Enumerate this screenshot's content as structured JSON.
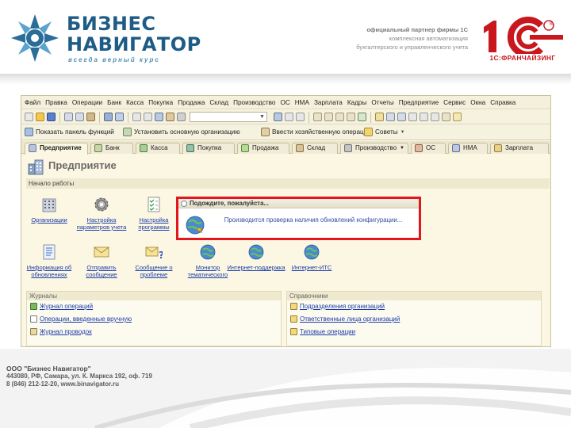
{
  "header": {
    "brand_line1": "БИЗНЕС",
    "brand_line2": "НАВИГАТОР",
    "tagline": "всегда верный курс",
    "partner_line1": "официальный партнер фирмы 1С",
    "partner_line2": "комплексная автоматизация",
    "partner_line3": "бухгалтерского и управленческого учета",
    "franchise_label": "1С:ФРАНЧАЙЗИНГ"
  },
  "app": {
    "menu": [
      "Файл",
      "Правка",
      "Операции",
      "Банк",
      "Касса",
      "Покупка",
      "Продажа",
      "Склад",
      "Производство",
      "ОС",
      "НМА",
      "Зарплата",
      "Кадры",
      "Отчеты",
      "Предприятие",
      "Сервис",
      "Окна",
      "Справка"
    ],
    "toolbar2": {
      "show_panel": "Показать панель функций",
      "set_org": "Установить основную организацию",
      "enter_op": "Ввести хозяйственную операцию",
      "advice": "Советы"
    },
    "tabs": [
      "Предприятие",
      "Банк",
      "Касса",
      "Покупка",
      "Продажа",
      "Склад",
      "Производство",
      "ОС",
      "НМА",
      "Зарплата"
    ],
    "page_title": "Предприятие",
    "section_start": "Начало работы",
    "tiles_row1": [
      {
        "label": "Организации",
        "icon": "buildings-icon"
      },
      {
        "label": "Настройка параметров учета",
        "icon": "gear-icon"
      },
      {
        "label": "Настройка программы",
        "icon": "checklist-icon"
      }
    ],
    "tiles_row2": [
      {
        "label": "Информация об обновлениях",
        "icon": "document-list-icon"
      },
      {
        "label": "Отправить сообщение",
        "icon": "mail-icon"
      },
      {
        "label": "Сообщение о проблеме",
        "icon": "mail-question-icon"
      },
      {
        "label": "Монитор тематического",
        "icon": "globe-icon"
      },
      {
        "label": "Интернет-поддержка",
        "icon": "globe-icon"
      },
      {
        "label": "Интернет-ИТС",
        "icon": "globe-icon"
      }
    ],
    "journals": {
      "title": "Журналы",
      "items": [
        "Журнал операций",
        "Операции, введенные вручную",
        "Журнал проводок"
      ]
    },
    "references": {
      "title": "Справочники",
      "items": [
        "Подразделения организаций",
        "Ответственные лица организаций",
        "Типовые операции"
      ]
    },
    "dialog": {
      "title": "Подождите, пожалуйста...",
      "message": "Производится проверка наличия обновлений конфигурации..."
    }
  },
  "footer": {
    "company": "ООО \"Бизнес Навигатор\"",
    "address": "443080, РФ, Самара, ул. К. Маркса 192, оф. 719",
    "contacts": "8 (846) 212-12-20, www.binavigator.ru"
  },
  "colors": {
    "brand_blue": "#1e5b85",
    "onec_red": "#c8181e",
    "window_bg": "#fbf7e3",
    "link_blue": "#1a3aa8",
    "highlight_red": "#e2171d"
  }
}
